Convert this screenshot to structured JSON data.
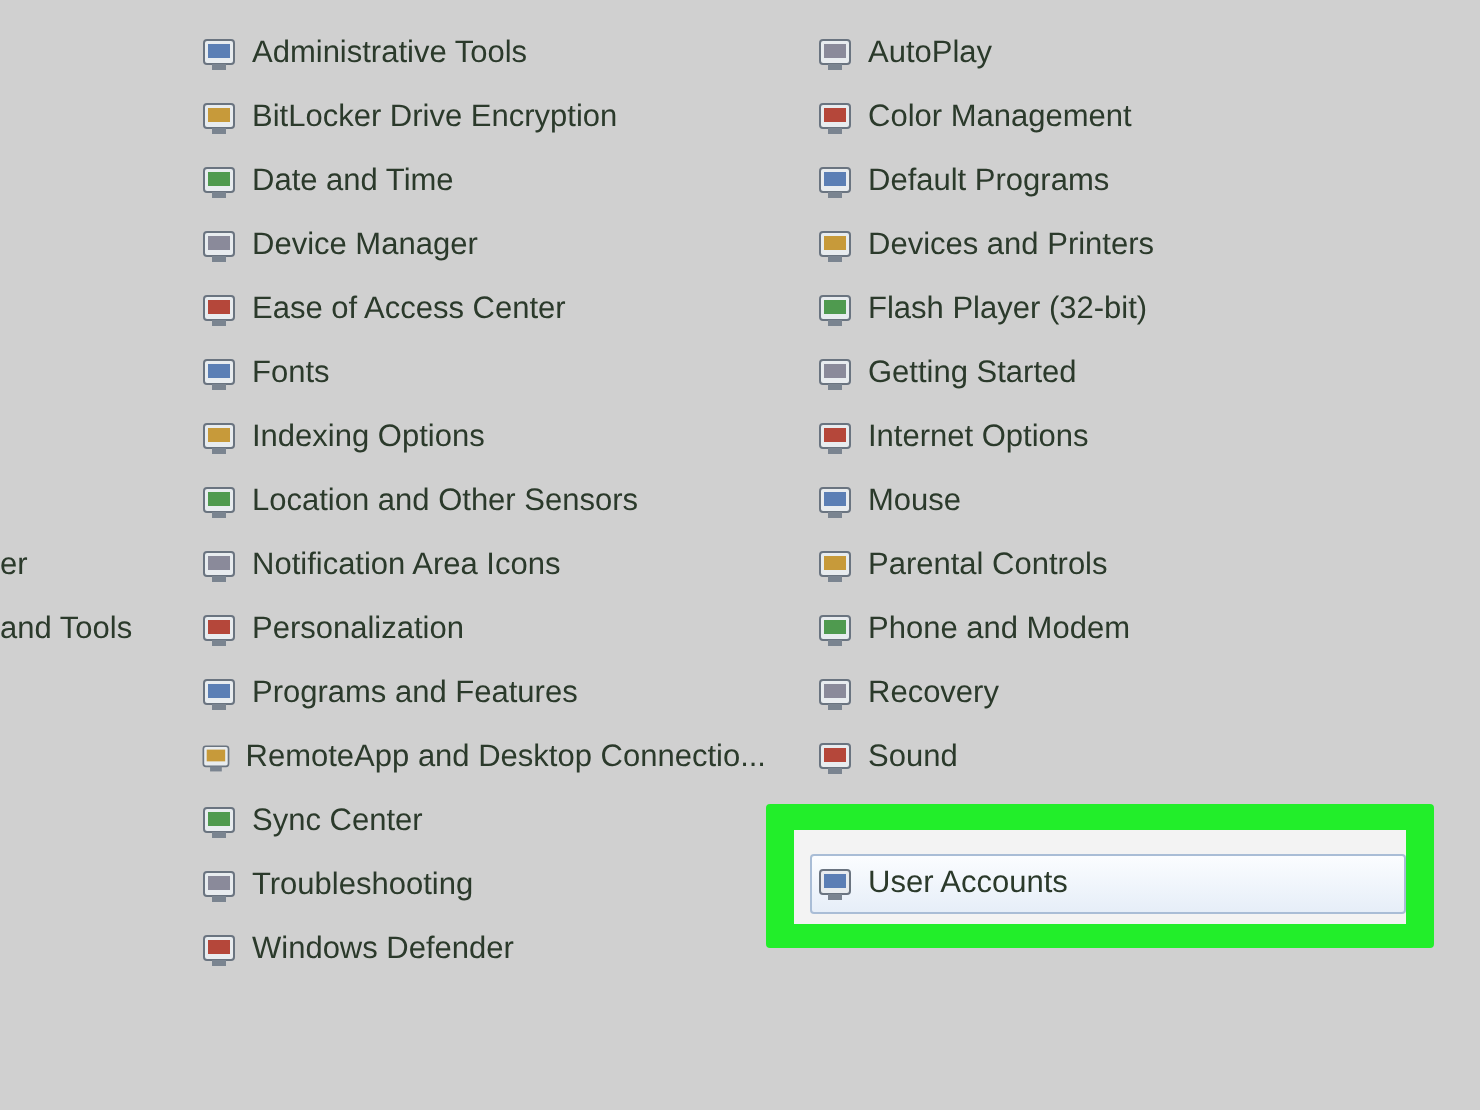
{
  "left_pane": {
    "items": [
      {
        "label": "er",
        "selected": false
      },
      {
        "label": "and Tools",
        "selected": false
      }
    ]
  },
  "columns": [
    {
      "items": [
        {
          "label": "Administrative Tools",
          "selected": false
        },
        {
          "label": "BitLocker Drive Encryption",
          "selected": false
        },
        {
          "label": "Date and Time",
          "selected": false
        },
        {
          "label": "Device Manager",
          "selected": false
        },
        {
          "label": "Ease of Access Center",
          "selected": false
        },
        {
          "label": "Fonts",
          "selected": false
        },
        {
          "label": "Indexing Options",
          "selected": false
        },
        {
          "label": "Location and Other Sensors",
          "selected": false
        },
        {
          "label": "Notification Area Icons",
          "selected": false
        },
        {
          "label": "Personalization",
          "selected": false
        },
        {
          "label": "Programs and Features",
          "selected": false
        },
        {
          "label": "RemoteApp and Desktop Connectio...",
          "selected": false
        },
        {
          "label": "Sync Center",
          "selected": false
        },
        {
          "label": "Troubleshooting",
          "selected": false
        },
        {
          "label": "Windows Defender",
          "selected": false
        }
      ]
    },
    {
      "items": [
        {
          "label": "AutoPlay",
          "selected": false
        },
        {
          "label": "Color Management",
          "selected": false
        },
        {
          "label": "Default Programs",
          "selected": false
        },
        {
          "label": "Devices and Printers",
          "selected": false
        },
        {
          "label": "Flash Player (32-bit)",
          "selected": false
        },
        {
          "label": "Getting Started",
          "selected": false
        },
        {
          "label": "Internet Options",
          "selected": false
        },
        {
          "label": "Mouse",
          "selected": false
        },
        {
          "label": "Parental Controls",
          "selected": false
        },
        {
          "label": "Phone and Modem",
          "selected": false
        },
        {
          "label": "Recovery",
          "selected": false
        },
        {
          "label": "Sound",
          "selected": false
        },
        {
          "label": "User Accounts",
          "selected": true,
          "highlighted": true
        }
      ]
    }
  ]
}
